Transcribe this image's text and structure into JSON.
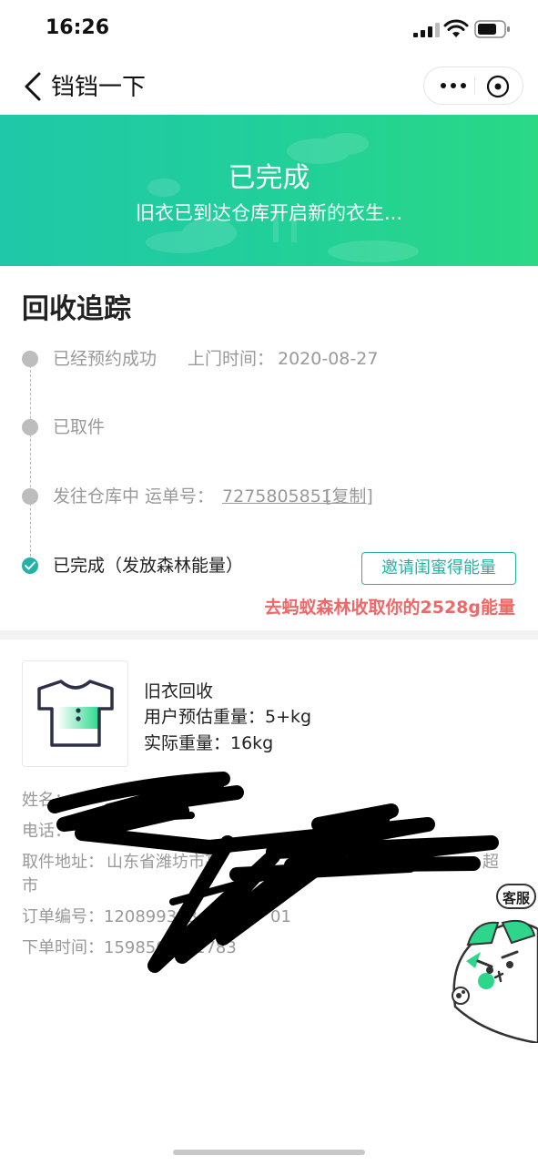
{
  "status_bar": {
    "time": "16:26"
  },
  "nav": {
    "title": "铛铛一下",
    "back_icon": "chevron-left-icon",
    "more_icon": "more-dots-icon",
    "close_icon": "close-circle-icon"
  },
  "banner": {
    "title": "已完成",
    "subtitle": "旧衣已到达仓库开启新的衣生..."
  },
  "tracking": {
    "title": "回收追踪",
    "steps": [
      {
        "label": "已经预约成功",
        "extra_label": "上门时间：",
        "extra_value": "2020-08-27"
      },
      {
        "label": "已取件"
      },
      {
        "label": "发往仓库中 运单号：",
        "waybill": "7275805851",
        "copy": "[复制]"
      },
      {
        "label": "已完成（发放森林能量）"
      }
    ],
    "invite_button": "邀请闺蜜得能量",
    "energy_tip": "去蚂蚁森林收取你的2528g能量"
  },
  "product": {
    "icon": "tshirt-icon",
    "name": "旧衣回收",
    "estimated_weight": "用户预估重量：5+kg",
    "actual_weight": "实际重量：16kg"
  },
  "order_info": {
    "name": "姓名：",
    "phone": "电话：",
    "address_label": "取件地址：",
    "address_value": "山东省潍坊市高",
    "address_tail": "超",
    "address_line2": "市",
    "order_no": "订单编号：120899303",
    "order_no_tail": "01",
    "order_time": "下单时间：159850",
    "order_time_tail": "1783"
  },
  "customer_service": {
    "label": "客服"
  },
  "colors": {
    "accent": "#23b2a6",
    "banner_start": "#1fc8a8",
    "banner_end": "#2ad886",
    "energy_tip": "#f06767"
  }
}
